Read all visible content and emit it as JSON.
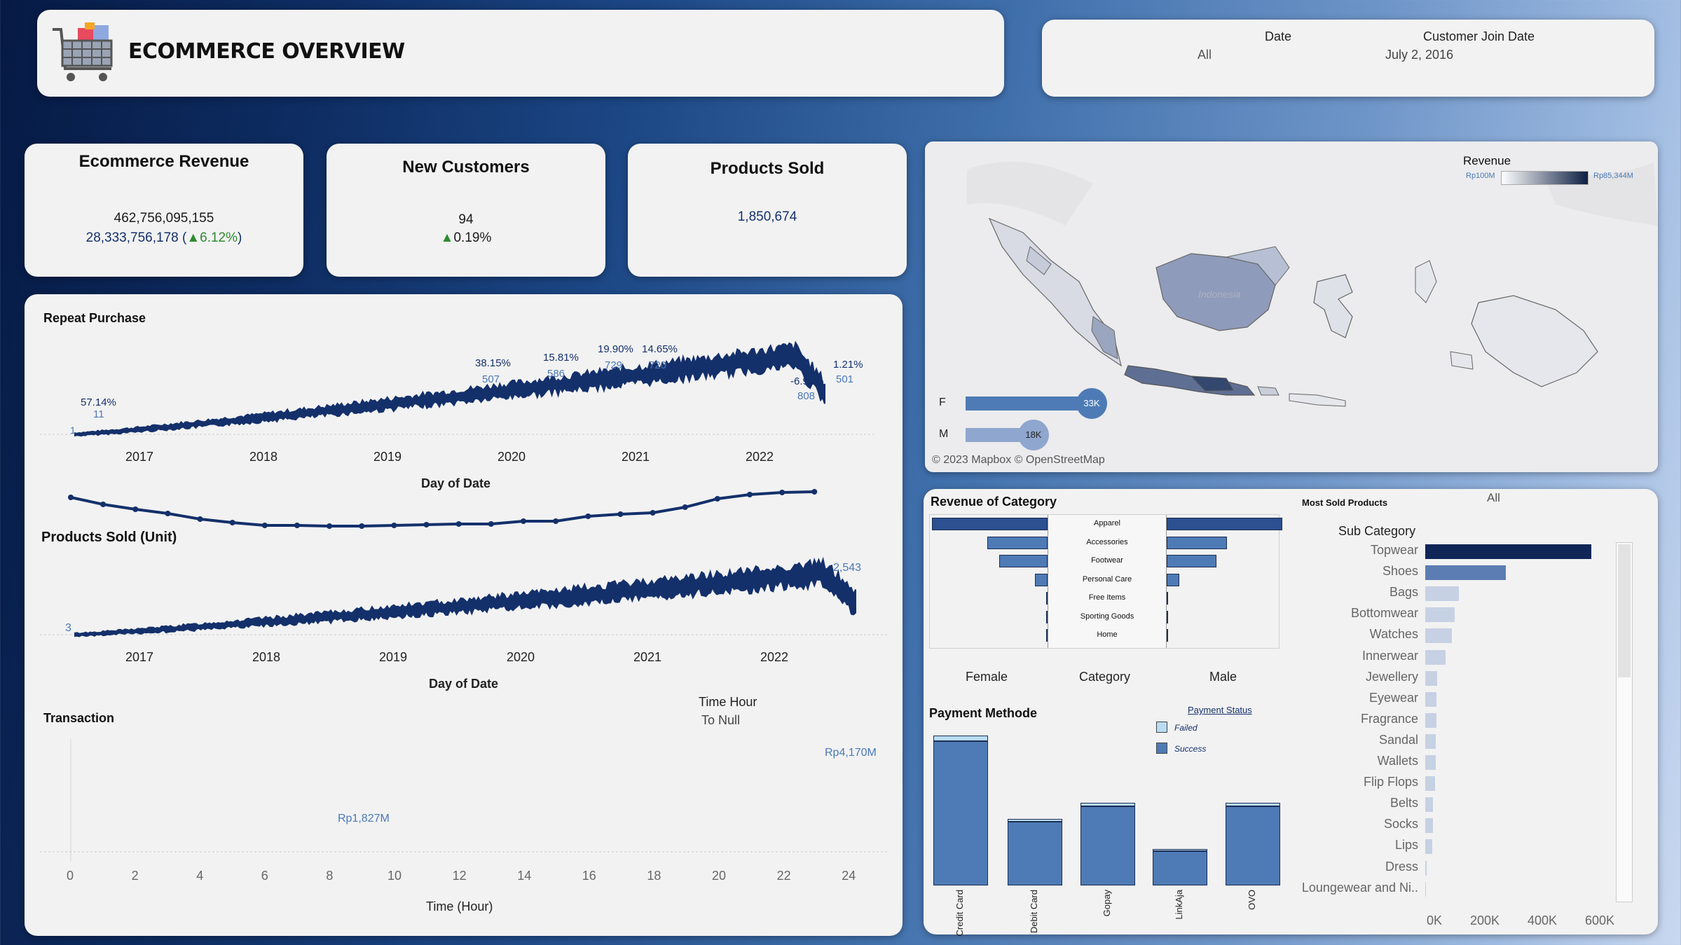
{
  "header": {
    "title": "ECOMMERCE OVERVIEW",
    "logo_icon": "shopping-cart-icon"
  },
  "filters": {
    "date_label": "Date",
    "date_value": "All",
    "join_label": "Customer Join Date",
    "join_value": "July 2, 2016"
  },
  "kpis": {
    "revenue": {
      "title": "Ecommerce Revenue",
      "value": "462,756,095,155",
      "delta": "28,333,756,178",
      "pct_open": " (",
      "pct_arrow": "▲",
      "pct": "6.12%",
      "pct_close": ")"
    },
    "customers": {
      "title": "New Customers",
      "value": "94",
      "arrow": "▲",
      "pct": "0.19%"
    },
    "products": {
      "title": "Products Sold",
      "value": "1,850,674"
    }
  },
  "repeat_purchase": {
    "title": "Repeat Purchase",
    "x_ticks": [
      "2017",
      "2018",
      "2019",
      "2020",
      "2021",
      "2022"
    ],
    "x_title": "Day of Date",
    "annotations": [
      {
        "pct": "57.14%",
        "val": "11"
      },
      {
        "pct": "38.15%",
        "val": "507"
      },
      {
        "pct": "15.81%",
        "val": "586"
      },
      {
        "pct": "19.90%",
        "val": "729"
      },
      {
        "pct": "14.65%",
        "val": "720"
      },
      {
        "pct": "-6.91%",
        "val": "808"
      },
      {
        "pct": "1.21%",
        "val": "501"
      }
    ],
    "start_label": "1"
  },
  "products_sold": {
    "title": "Products Sold (Unit)",
    "x_ticks": [
      "2017",
      "2018",
      "2019",
      "2020",
      "2021",
      "2022"
    ],
    "x_title": "Day of Date",
    "start_label": "3",
    "end_label": "2,543"
  },
  "transaction": {
    "title": "Transaction",
    "legend_title": "Time Hour",
    "legend_value": "To Null",
    "x_title": "Time (Hour)",
    "x_ticks": [
      "0",
      "2",
      "4",
      "6",
      "8",
      "10",
      "12",
      "14",
      "16",
      "18",
      "20",
      "22",
      "24"
    ],
    "min_label": "Rp1,827M",
    "max_label": "Rp4,170M"
  },
  "map": {
    "legend_title": "Revenue",
    "legend_min": "Rp100M",
    "legend_max": "Rp85,344M",
    "credit": "© 2023 Mapbox © OpenStreetMap",
    "country_label": "Indonesia",
    "gender": [
      {
        "label": "F",
        "value": "33K",
        "share": 0.65
      },
      {
        "label": "M",
        "value": "18K",
        "share": 0.35
      }
    ]
  },
  "revenue_category": {
    "title": "Revenue of Category",
    "categories": [
      "Apparel",
      "Accessories",
      "Footwear",
      "Personal Care",
      "Free Items",
      "Sporting Goods",
      "Home"
    ],
    "female": [
      1.0,
      0.52,
      0.42,
      0.11,
      0.01,
      0.01,
      0.01
    ],
    "male": [
      1.0,
      0.52,
      0.43,
      0.11,
      0.01,
      0.01,
      0.01
    ],
    "col_female": "Female",
    "col_category": "Category",
    "col_male": "Male"
  },
  "payment": {
    "title": "Payment Methode",
    "status_title": "Payment Status",
    "status_failed": "Failed",
    "status_success": "Success",
    "methods": [
      "Credit Card",
      "Debit Card",
      "Gopay",
      "LinkAja",
      "OVO"
    ],
    "success": [
      1.0,
      0.44,
      0.55,
      0.24,
      0.55
    ],
    "failed": [
      0.04,
      0.02,
      0.025,
      0.01,
      0.025
    ]
  },
  "most_sold": {
    "title": "Most Sold Products",
    "filter_value": "All",
    "col_title": "Sub Category",
    "items": [
      "Topwear",
      "Shoes",
      "Bags",
      "Bottomwear",
      "Watches",
      "Innerwear",
      "Jewellery",
      "Eyewear",
      "Fragrance",
      "Sandal",
      "Wallets",
      "Flip Flops",
      "Belts",
      "Socks",
      "Lips",
      "Dress",
      "Loungewear and Ni.."
    ],
    "values": [
      620000,
      300000,
      125000,
      110000,
      100000,
      75000,
      45000,
      42000,
      42000,
      40000,
      38000,
      36000,
      30000,
      30000,
      25000,
      5000,
      3000
    ],
    "x_ticks": [
      "0K",
      "200K",
      "400K",
      "600K"
    ],
    "x_max": 680000
  }
}
